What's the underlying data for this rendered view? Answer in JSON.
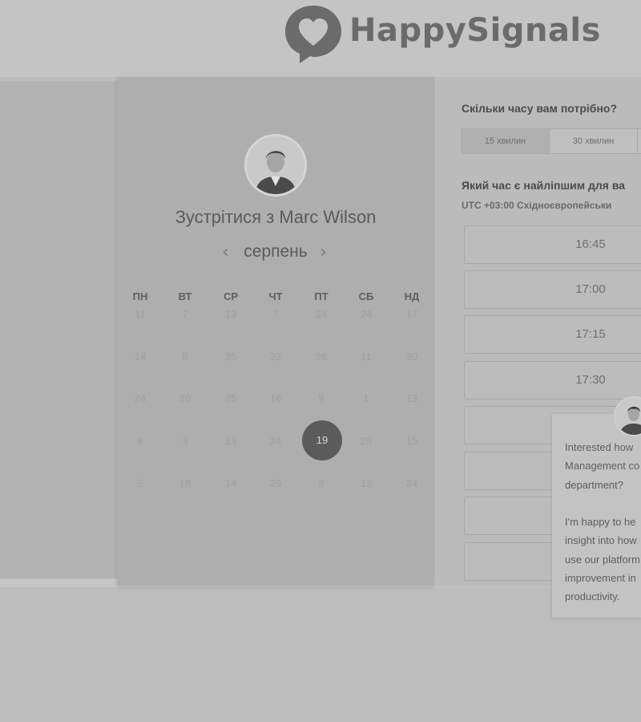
{
  "brand": {
    "name": "HappySignals"
  },
  "calendar": {
    "meet_title": "Зустрітися з Marc Wilson",
    "month": "серпень",
    "prev_icon": "chevron-left-icon",
    "next_icon": "chevron-right-icon",
    "weekdays": [
      "ПН",
      "ВТ",
      "СР",
      "ЧТ",
      "ПТ",
      "СБ",
      "НД"
    ],
    "weeks": [
      [
        "11",
        "7",
        "13",
        "7",
        "24",
        "24",
        "17"
      ],
      [
        "14",
        "8",
        "25",
        "22",
        "26",
        "11",
        "30"
      ],
      [
        "24",
        "26",
        "25",
        "16",
        "9",
        "1",
        "13"
      ],
      [
        "9",
        "3",
        "13",
        "24",
        "19",
        "29",
        "15"
      ],
      [
        "5",
        "18",
        "14",
        "29",
        "8",
        "12",
        "24"
      ]
    ],
    "selected_day": "19"
  },
  "booking": {
    "duration_question": "Скільки часу вам потрібно?",
    "durations": [
      "15 хвилин",
      "30 хвилин"
    ],
    "active_duration": "15 хвилин",
    "time_question": "Який час є найліпшим для ва",
    "timezone": "UTC +03:00 Східноєвропейськи",
    "slots": [
      "16:45",
      "17:00",
      "17:15",
      "17:30",
      "",
      "",
      "",
      ""
    ]
  },
  "chat": {
    "message": "Interested how\nManagement co\ndepartment?\n\nI'm happy to he\ninsight into how\nuse our platform\nimprovement in\nproductivity."
  }
}
